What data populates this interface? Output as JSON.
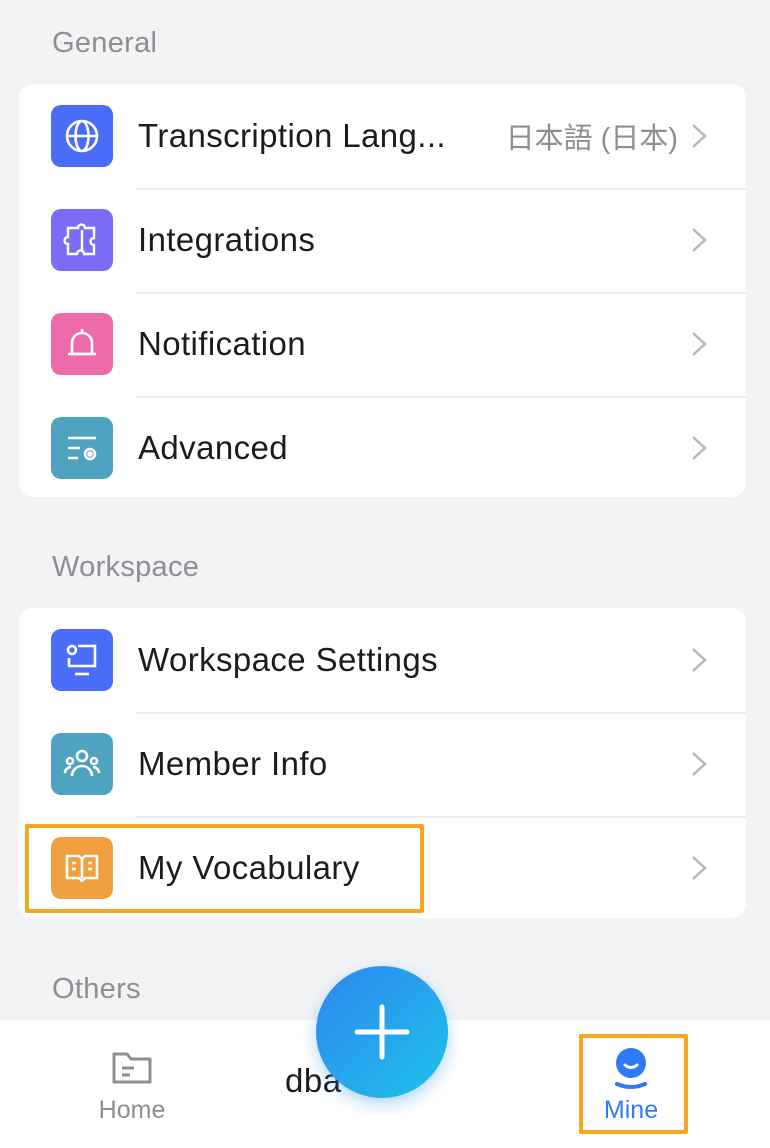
{
  "sections": {
    "general": {
      "title": "General",
      "items": [
        {
          "label": "Transcription Lang...",
          "value": "日本語 (日本)",
          "icon": "globe-icon",
          "color": "#4a6cf7"
        },
        {
          "label": "Integrations",
          "icon": "puzzle-icon",
          "color": "#7b6cf6"
        },
        {
          "label": "Notification",
          "icon": "bell-icon",
          "color": "#ef6aa8"
        },
        {
          "label": "Advanced",
          "icon": "settings-list-icon",
          "color": "#4fa3c0"
        }
      ]
    },
    "workspace": {
      "title": "Workspace",
      "items": [
        {
          "label": "Workspace Settings",
          "icon": "monitor-gear-icon",
          "color": "#4a6cf7"
        },
        {
          "label": "Member Info",
          "icon": "members-icon",
          "color": "#4fa3c0"
        },
        {
          "label": "My Vocabulary",
          "icon": "book-icon",
          "color": "#f0a040"
        }
      ]
    },
    "others": {
      "title": "Others"
    }
  },
  "partial_text": "dba",
  "tabbar": {
    "home_label": "Home",
    "mine_label": "Mine",
    "active_color": "#2f7bf5",
    "inactive_color": "#8e8e93"
  },
  "highlight_color": "#f5a623",
  "fab": {
    "icon": "plus-icon"
  }
}
